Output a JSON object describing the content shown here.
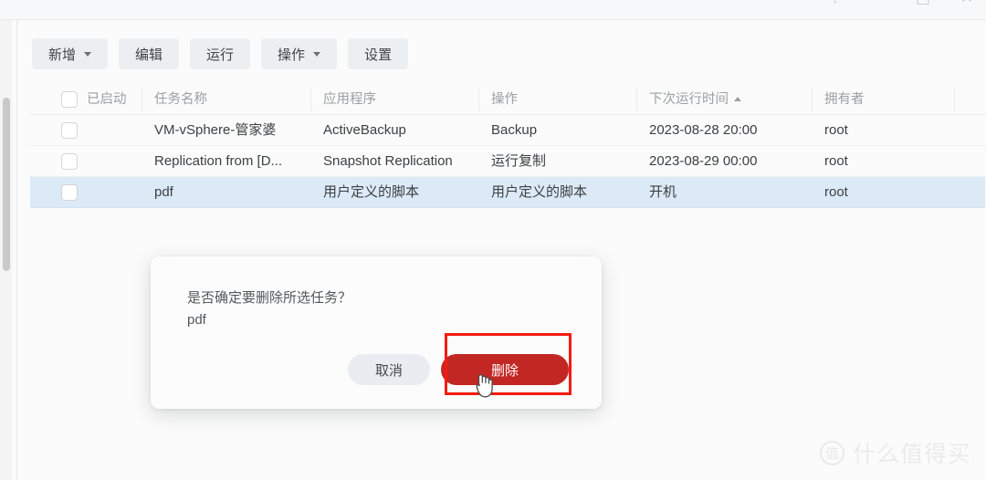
{
  "window": {
    "controls": [
      {
        "name": "help-icon",
        "glyph": "?"
      },
      {
        "name": "minimize-icon",
        "glyph": "—"
      },
      {
        "name": "maximize-icon",
        "glyph": "□"
      },
      {
        "name": "close-icon",
        "glyph": "✕"
      }
    ]
  },
  "toolbar": {
    "buttons": [
      {
        "label": "新增",
        "has_caret": true
      },
      {
        "label": "编辑",
        "has_caret": false
      },
      {
        "label": "运行",
        "has_caret": false
      },
      {
        "label": "操作",
        "has_caret": true
      },
      {
        "label": "设置",
        "has_caret": false
      }
    ]
  },
  "table": {
    "columns": [
      {
        "label": "已启动",
        "sorted": false
      },
      {
        "label": "任务名称",
        "sorted": false
      },
      {
        "label": "应用程序",
        "sorted": false
      },
      {
        "label": "操作",
        "sorted": false
      },
      {
        "label": "下次运行时间",
        "sorted": true
      },
      {
        "label": "拥有者",
        "sorted": false
      }
    ],
    "rows": [
      {
        "name": "VM-vSphere-管家婆",
        "app": "ActiveBackup",
        "operation": "Backup",
        "next_run": "2023-08-28 20:00",
        "owner": "root",
        "checked": false,
        "selected": false
      },
      {
        "name": "Replication from [D...",
        "app": "Snapshot Replication",
        "operation": "运行复制",
        "next_run": "2023-08-29 00:00",
        "owner": "root",
        "checked": false,
        "selected": false
      },
      {
        "name": "pdf",
        "app": "用户定义的脚本",
        "operation": "用户定义的脚本",
        "next_run": "开机",
        "owner": "root",
        "checked": false,
        "selected": true
      }
    ]
  },
  "dialog": {
    "message": "是否确定要删除所选任务？",
    "subject": "pdf",
    "cancel_label": "取消",
    "confirm_label": "删除"
  },
  "annotation": {
    "color": "#f41b11",
    "target": "删除"
  },
  "watermark": {
    "badge": "值",
    "text": "什么值得买"
  },
  "colors": {
    "accent_danger": "#c22723",
    "annotation_red": "#f41b11",
    "row_selected": "#dce9f6",
    "toolbar_button": "#eceff2",
    "background": "#fafafa"
  }
}
